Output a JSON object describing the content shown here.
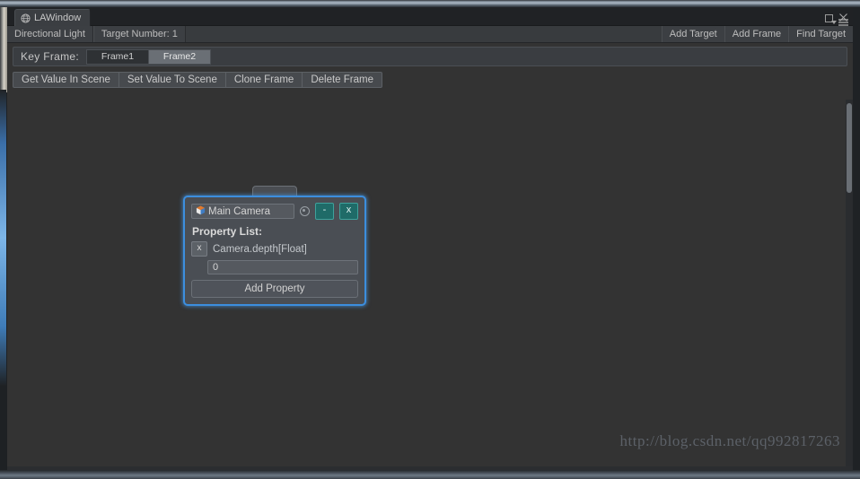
{
  "window": {
    "tab_title": "LAWindow",
    "tab_icon": "globe-icon",
    "maximize_icon": "maximize-icon",
    "close_icon": "close-icon",
    "menu_icon": "hamburger-menu-icon"
  },
  "target_bar": {
    "left_buttons": [
      {
        "label": "Directional Light"
      },
      {
        "label": "Target Number: 1"
      }
    ],
    "right_buttons": [
      {
        "label": "Add Target"
      },
      {
        "label": "Add Frame"
      },
      {
        "label": "Find Target"
      }
    ]
  },
  "key_frame_bar": {
    "label": "Key Frame:",
    "frames": [
      {
        "label": "Frame1",
        "selected": false
      },
      {
        "label": "Frame2",
        "selected": true
      }
    ]
  },
  "actions": [
    {
      "label": "Get Value In Scene"
    },
    {
      "label": "Set Value To Scene"
    },
    {
      "label": "Clone Frame"
    },
    {
      "label": "Delete Frame"
    }
  ],
  "node_panel": {
    "object_name": "Main Camera",
    "object_icon": "prefab-cube-icon",
    "picker_icon": "object-picker-icon",
    "minimize_label": "-",
    "close_label": "x",
    "property_list_title": "Property List:",
    "properties": [
      {
        "remove_label": "x",
        "name": "Camera.depth[Float]",
        "value": "0"
      }
    ],
    "add_property_label": "Add Property"
  },
  "watermark": {
    "text": "http://blog.csdn.net/qq992817263"
  },
  "colors": {
    "accent_border": "#3c8ede",
    "panel_bg": "#4a4e54",
    "window_bg": "#333333",
    "teal_button": "#1f6b68",
    "selected_tab": "#6a6f75"
  }
}
